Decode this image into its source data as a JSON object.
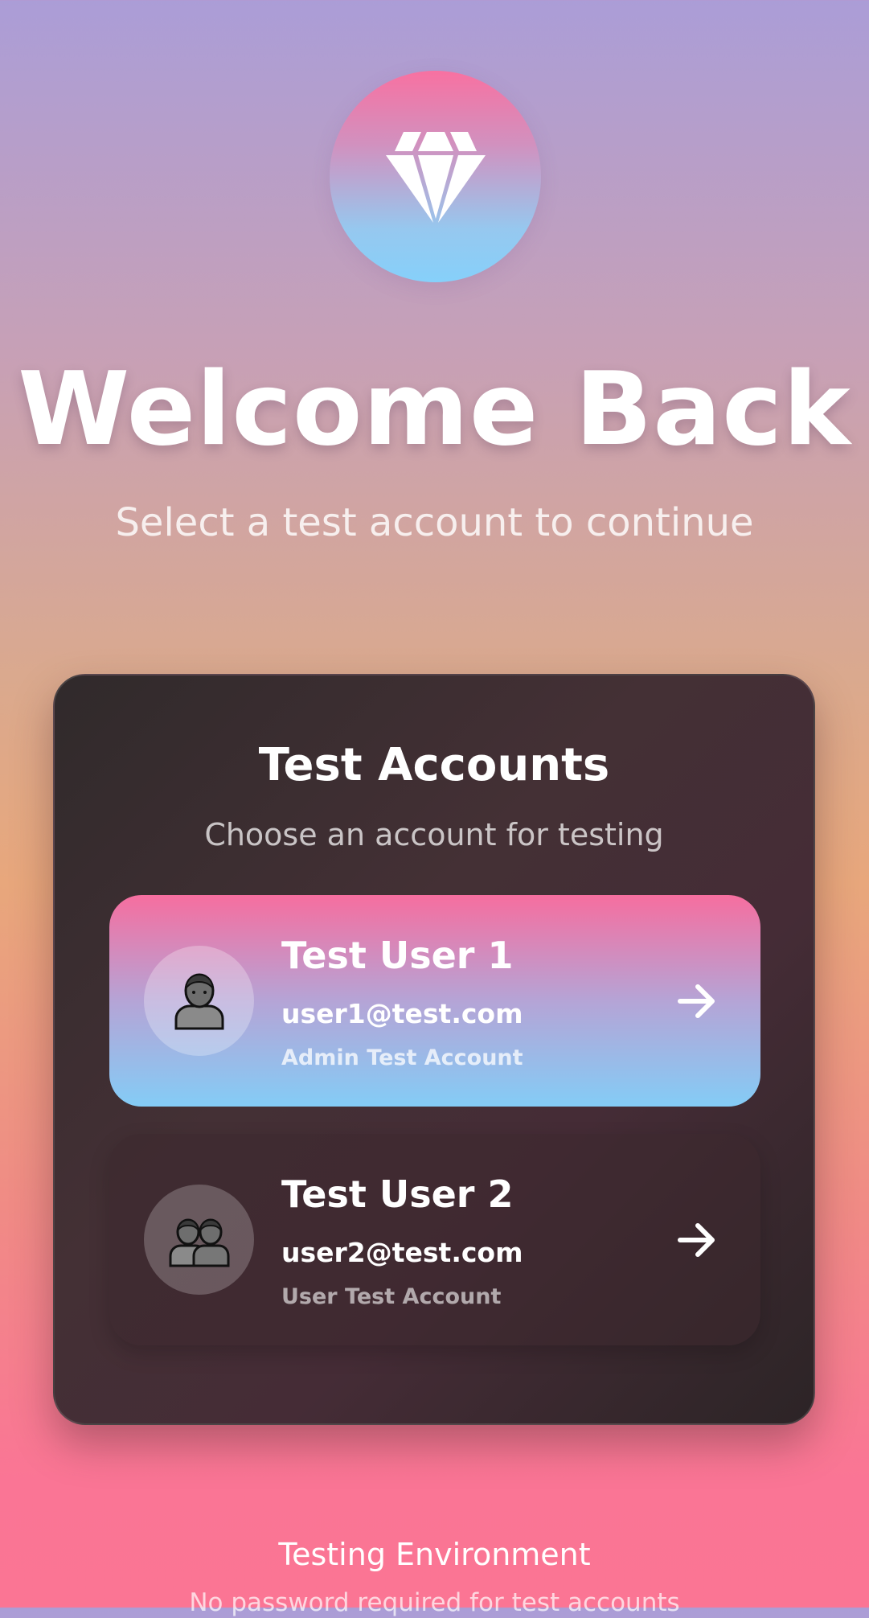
{
  "header": {
    "logo_icon": "diamond-icon",
    "title": "Welcome Back",
    "subtitle": "Select a test account to continue"
  },
  "card": {
    "title": "Test Accounts",
    "subtitle": "Choose an account for testing",
    "accounts": [
      {
        "name": "Test User 1",
        "email": "user1@test.com",
        "role": "Admin Test Account",
        "avatar_icon": "person-icon",
        "action_icon": "arrow-right-icon",
        "selected": true
      },
      {
        "name": "Test User 2",
        "email": "user2@test.com",
        "role": "User Test Account",
        "avatar_icon": "two-people-icon",
        "action_icon": "arrow-right-icon",
        "selected": false
      }
    ]
  },
  "footer": {
    "title": "Testing Environment",
    "subtitle": "No password required for test accounts"
  },
  "colors": {
    "accent_pink": "#f66e9f",
    "accent_blue": "#84ccf6",
    "card_background": "#3a2a2f"
  }
}
